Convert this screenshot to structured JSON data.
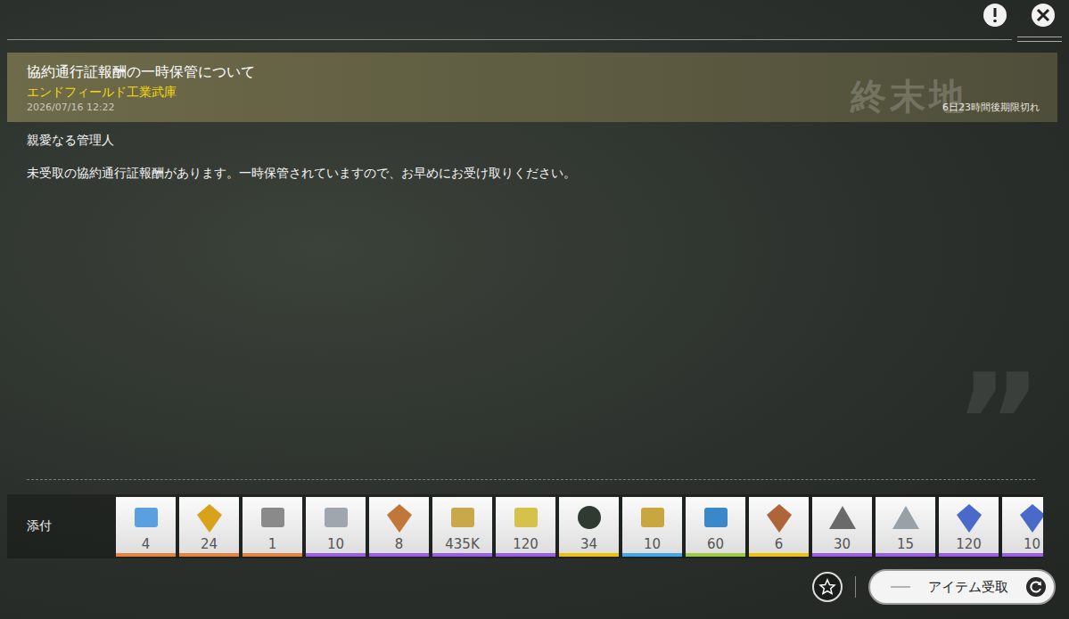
{
  "mail": {
    "title": "協約通行証報酬の一時保管について",
    "sender": "エンドフィールド工業武庫",
    "date": "2026/07/16 12:22",
    "expiry": "6日23時間後期限切れ",
    "watermark": "終末地",
    "greeting": "親愛なる管理人",
    "body": "未受取の協約通行証報酬があります。一時保管されていますので、お早めにお受け取りください。"
  },
  "quote_mark": "”",
  "attachments": {
    "label": "添付",
    "items": [
      {
        "count": "4",
        "color": "#e8843a"
      },
      {
        "count": "24",
        "color": "#e8843a"
      },
      {
        "count": "1",
        "color": "#e8843a"
      },
      {
        "count": "10",
        "color": "#9b5de5"
      },
      {
        "count": "8",
        "color": "#9b5de5"
      },
      {
        "count": "435K",
        "color": "#9b5de5"
      },
      {
        "count": "120",
        "color": "#9b5de5"
      },
      {
        "count": "34",
        "color": "#f2c200"
      },
      {
        "count": "10",
        "color": "#3fa9e8"
      },
      {
        "count": "60",
        "color": "#9ccc3a"
      },
      {
        "count": "6",
        "color": "#f2c200"
      },
      {
        "count": "30",
        "color": "#9b5de5"
      },
      {
        "count": "15",
        "color": "#9b5de5"
      },
      {
        "count": "120",
        "color": "#9b5de5"
      },
      {
        "count": "10",
        "color": "#9b5de5"
      }
    ]
  },
  "buttons": {
    "receive": "アイテム受取"
  }
}
